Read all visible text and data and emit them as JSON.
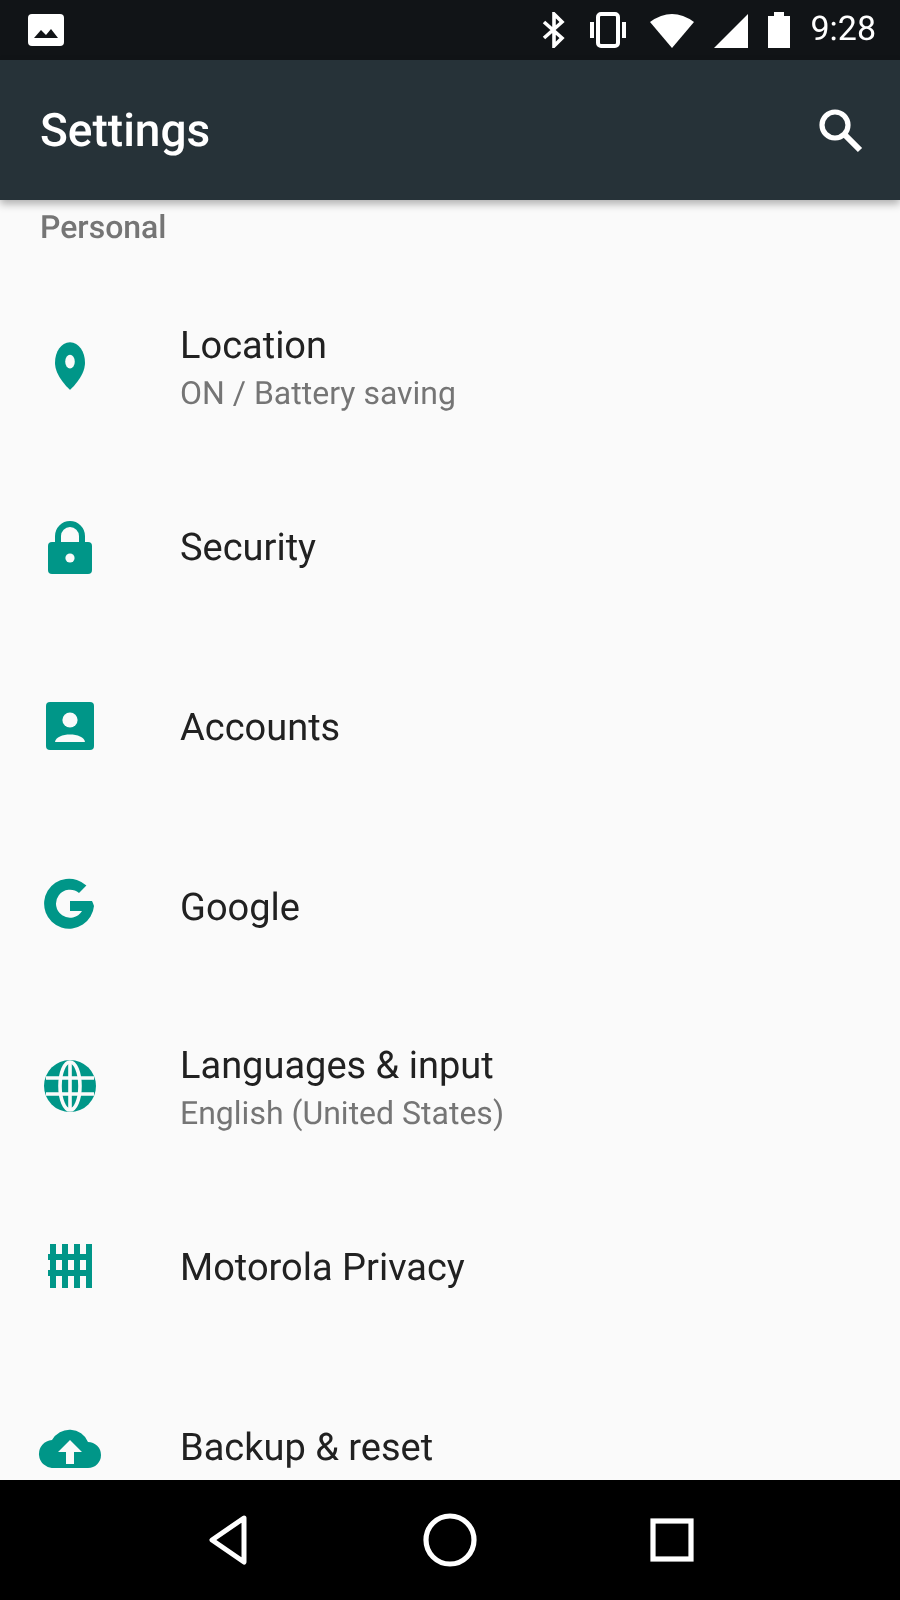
{
  "status_bar": {
    "time": "9:28"
  },
  "app_bar": {
    "title": "Settings"
  },
  "section": {
    "title": "Personal"
  },
  "items": [
    {
      "title": "Location",
      "subtitle": "ON / Battery saving"
    },
    {
      "title": "Security"
    },
    {
      "title": "Accounts"
    },
    {
      "title": "Google"
    },
    {
      "title": "Languages & input",
      "subtitle": "English (United States)"
    },
    {
      "title": "Motorola Privacy"
    },
    {
      "title": "Backup & reset"
    }
  ]
}
